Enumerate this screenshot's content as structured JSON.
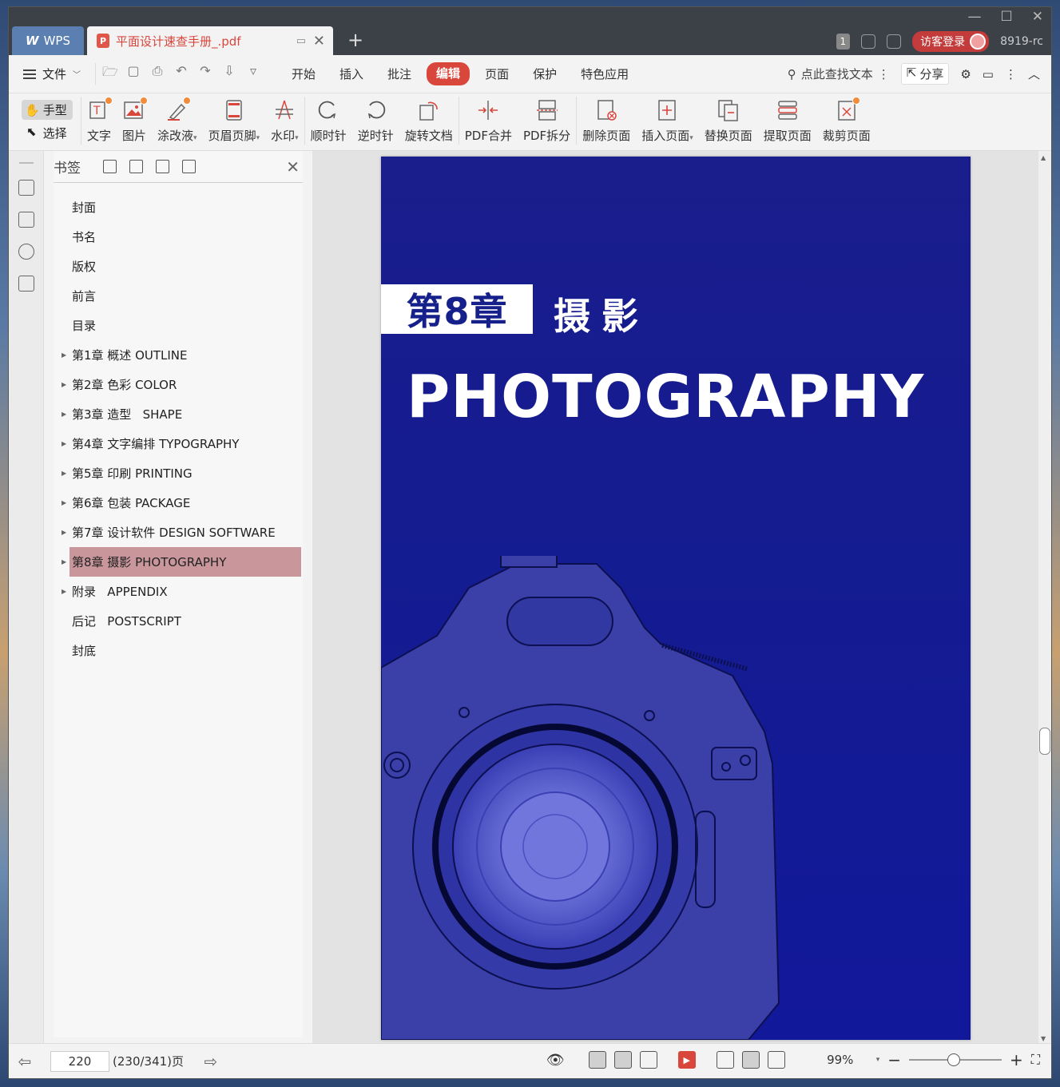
{
  "titlebar": {
    "app_tab": "WPS",
    "doc_tab": "平面设计速查手册_.pdf",
    "new_tab": "+",
    "page_count_badge": "1",
    "login_label": "访客登录",
    "user_id": "8919-rc"
  },
  "menubar": {
    "file": "文件",
    "items": [
      "开始",
      "插入",
      "批注",
      "编辑",
      "页面",
      "保护",
      "特色应用"
    ],
    "active": "编辑",
    "search_label": "点此查找文本",
    "share_label": "分享"
  },
  "ribbon": {
    "hand": "手型",
    "select": "选择",
    "tools": [
      {
        "label": "文字",
        "icon": "text-edit-icon"
      },
      {
        "label": "图片",
        "icon": "image-edit-icon"
      },
      {
        "label": "涂改液",
        "icon": "correction-pen-icon"
      },
      {
        "label": "页眉页脚",
        "icon": "header-footer-icon"
      },
      {
        "label": "水印",
        "icon": "watermark-icon"
      },
      {
        "label": "顺时针",
        "icon": "rotate-cw-icon"
      },
      {
        "label": "逆时针",
        "icon": "rotate-ccw-icon"
      },
      {
        "label": "旋转文档",
        "icon": "rotate-doc-icon"
      },
      {
        "label": "PDF合并",
        "icon": "pdf-merge-icon"
      },
      {
        "label": "PDF拆分",
        "icon": "pdf-split-icon"
      },
      {
        "label": "删除页面",
        "icon": "delete-page-icon"
      },
      {
        "label": "插入页面",
        "icon": "insert-page-icon"
      },
      {
        "label": "替换页面",
        "icon": "replace-page-icon"
      },
      {
        "label": "提取页面",
        "icon": "extract-page-icon"
      },
      {
        "label": "裁剪页面",
        "icon": "crop-page-icon"
      }
    ]
  },
  "bookmarks": {
    "title": "书签",
    "items": [
      {
        "label": "封面",
        "expandable": false
      },
      {
        "label": "书名",
        "expandable": false
      },
      {
        "label": "版权",
        "expandable": false
      },
      {
        "label": "前言",
        "expandable": false
      },
      {
        "label": "目录",
        "expandable": false
      },
      {
        "label": "第1章 概述 OUTLINE",
        "expandable": true
      },
      {
        "label": "第2章 色彩 COLOR",
        "expandable": true
      },
      {
        "label": "第3章 造型   SHAPE",
        "expandable": true
      },
      {
        "label": "第4章 文字编排 TYPOGRAPHY",
        "expandable": true
      },
      {
        "label": "第5章 印刷 PRINTING",
        "expandable": true
      },
      {
        "label": "第6章 包装 PACKAGE",
        "expandable": true
      },
      {
        "label": "第7章 设计软件 DESIGN SOFTWARE",
        "expandable": true
      },
      {
        "label": "第8章 摄影 PHOTOGRAPHY",
        "expandable": true,
        "selected": true
      },
      {
        "label": "附录   APPENDIX",
        "expandable": true
      },
      {
        "label": "后记   POSTSCRIPT",
        "expandable": false
      },
      {
        "label": "封底",
        "expandable": false
      }
    ]
  },
  "page": {
    "chapter_label": "第8章",
    "chapter_title": "摄影",
    "english_title": "PHOTOGRAPHY",
    "background_color": "#141c90"
  },
  "statusbar": {
    "page_input": "220",
    "page_total": "(230/341)页",
    "zoom": "99%"
  }
}
